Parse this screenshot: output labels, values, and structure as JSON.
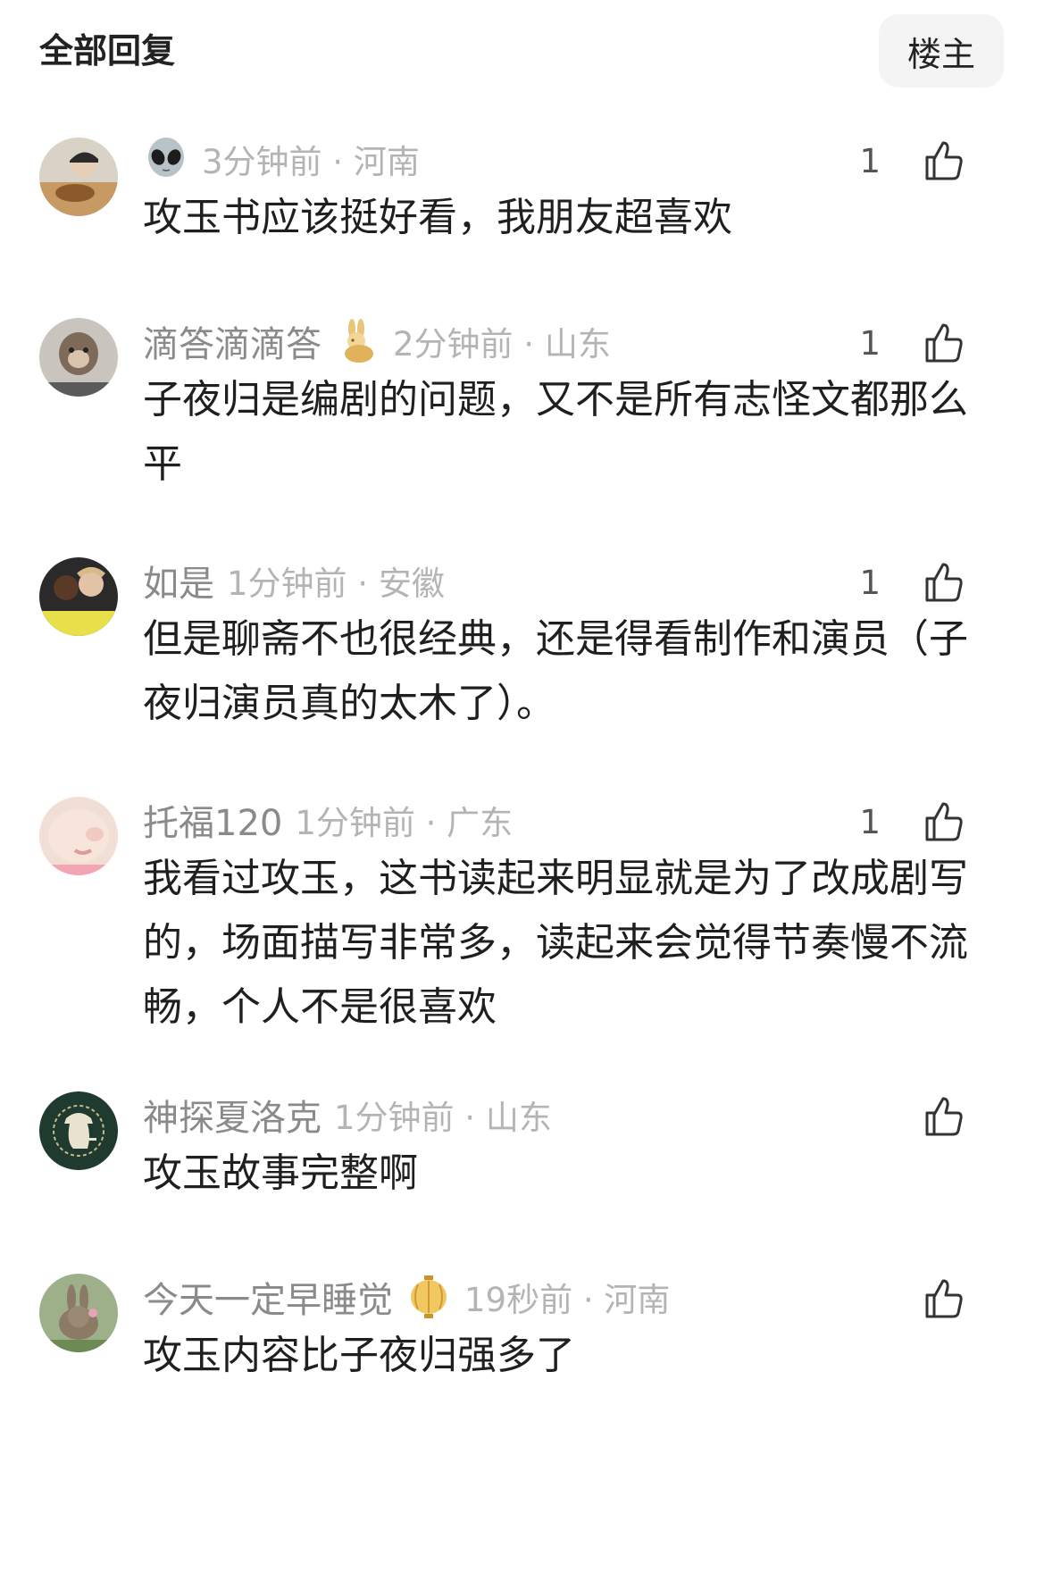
{
  "header": {
    "title": "全部回复",
    "owner_button": "楼主"
  },
  "comments": [
    {
      "username": "",
      "time_location": "3分钟前 · 河南",
      "likes": "1",
      "text": "攻玉书应该挺好看，我朋友超喜欢",
      "badge_icon": "alien-emoji-icon"
    },
    {
      "username": "滴答滴滴答",
      "time_location": "2分钟前 · 山东",
      "likes": "1",
      "text": "子夜归是编剧的问题，又不是所有志怪文都那么平",
      "badge_icon": "golden-rabbit-icon"
    },
    {
      "username": "如是",
      "time_location": "1分钟前 · 安徽",
      "likes": "1",
      "text": "但是聊斋不也很经典，还是得看制作和演员（子夜归演员真的太木了）。",
      "badge_icon": ""
    },
    {
      "username": "托福120",
      "time_location": "1分钟前 · 广东",
      "likes": "1",
      "text": "我看过攻玉，这书读起来明显就是为了改成剧写的，场面描写非常多，读起来会觉得节奏慢不流畅，个人不是很喜欢",
      "badge_icon": ""
    },
    {
      "username": "神探夏洛克",
      "time_location": "1分钟前 · 山东",
      "likes": "",
      "text": "攻玉故事完整啊",
      "badge_icon": ""
    },
    {
      "username": "今天一定早睡觉",
      "time_location": "19秒前 · 河南",
      "likes": "",
      "text": "攻玉内容比子夜归强多了",
      "badge_icon": "golden-lantern-icon"
    }
  ],
  "colors": {
    "username": "#8a8a8a",
    "time": "#b4b4b4",
    "text": "#1f1f1f",
    "button_bg": "#f4f4f4"
  }
}
